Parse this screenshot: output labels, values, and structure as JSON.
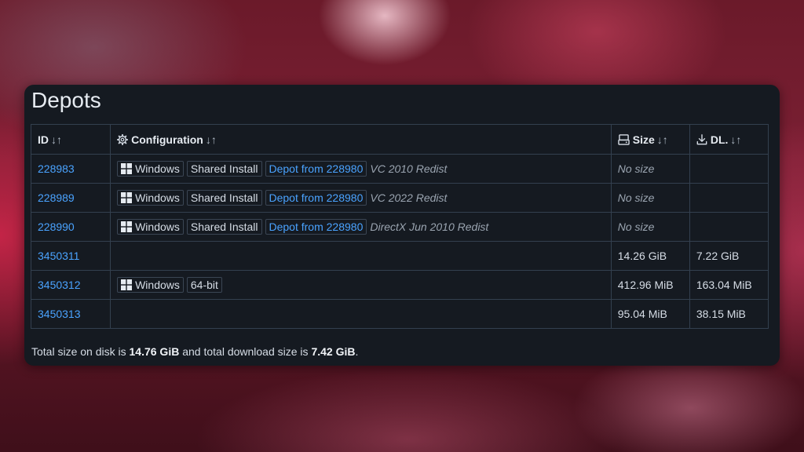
{
  "section": {
    "title": "Depots"
  },
  "table": {
    "headers": [
      {
        "label": "ID",
        "sort": "↓↑",
        "icon": ""
      },
      {
        "label": "Configuration",
        "sort": "↓↑",
        "icon": "gear-icon"
      },
      {
        "label": "Size",
        "sort": "↓↑",
        "icon": "disk-icon"
      },
      {
        "label": "DL.",
        "sort": "↓↑",
        "icon": "download-icon"
      }
    ],
    "rows": [
      {
        "id": "228983",
        "os": "Windows",
        "tag": "Shared Install",
        "depot_link": "Depot from 228980",
        "note": "VC 2010 Redist",
        "size": "No size",
        "dl": ""
      },
      {
        "id": "228989",
        "os": "Windows",
        "tag": "Shared Install",
        "depot_link": "Depot from 228980",
        "note": "VC 2022 Redist",
        "size": "No size",
        "dl": ""
      },
      {
        "id": "228990",
        "os": "Windows",
        "tag": "Shared Install",
        "depot_link": "Depot from 228980",
        "note": "DirectX Jun 2010 Redist",
        "size": "No size",
        "dl": ""
      },
      {
        "id": "3450311",
        "os": "",
        "tag": "",
        "depot_link": "",
        "note": "",
        "size": "14.26 GiB",
        "dl": "7.22 GiB"
      },
      {
        "id": "3450312",
        "os": "Windows",
        "tag": "64-bit",
        "depot_link": "",
        "note": "",
        "size": "412.96 MiB",
        "dl": "163.04 MiB"
      },
      {
        "id": "3450313",
        "os": "",
        "tag": "",
        "depot_link": "",
        "note": "",
        "size": "95.04 MiB",
        "dl": "38.15 MiB"
      }
    ]
  },
  "footer": {
    "prefix": "Total size on disk is ",
    "disk_total": "14.76 GiB",
    "middle": " and total download size is ",
    "download_total": "7.42 GiB",
    "suffix": "."
  },
  "colors": {
    "panel_bg": "#151a21",
    "link": "#4aa3ff",
    "border": "#33404f"
  }
}
